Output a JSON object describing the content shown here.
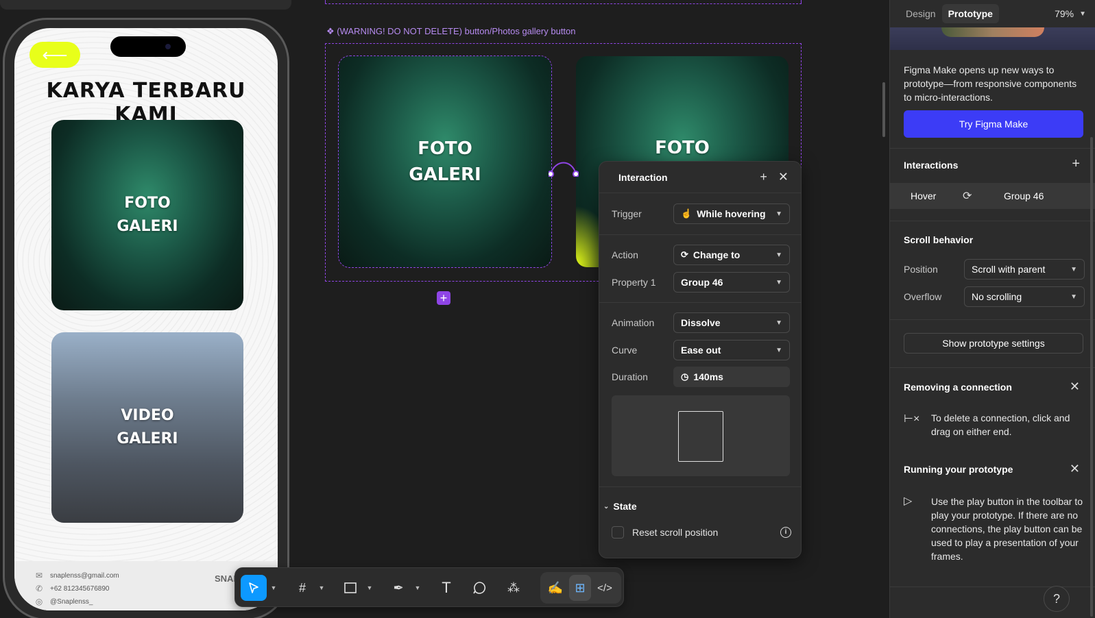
{
  "phone": {
    "back_arrow": "⟵",
    "title": "KARYA TERBARU KAMI",
    "card1": {
      "line1": "FOTO",
      "line2": "GALERI"
    },
    "card2": {
      "line1": "VIDEO",
      "line2": "GALERI"
    },
    "footer": {
      "email": "snaplenss@gmail.com",
      "phone": "+62 812345676890",
      "instagram": "@Snaplenss_",
      "logo_text": "SNAP"
    }
  },
  "canvas": {
    "component_label": "❖ (WARNING! DO NOT DELETE) button/Photos gallery button",
    "variant1": {
      "line1": "FOTO",
      "line2": "GALERI"
    },
    "variant2": {
      "line1": "FOTO",
      "line2": ""
    }
  },
  "interaction": {
    "title": "Interaction",
    "trigger_label": "Trigger",
    "trigger_value": "While hovering",
    "action_label": "Action",
    "action_value": "Change to",
    "property_label": "Property 1",
    "property_value": "Group 46",
    "animation_label": "Animation",
    "animation_value": "Dissolve",
    "curve_label": "Curve",
    "curve_value": "Ease out",
    "duration_label": "Duration",
    "duration_value": "140ms",
    "state_title": "State",
    "reset_scroll_label": "Reset scroll position"
  },
  "right_panel": {
    "tab_design": "Design",
    "tab_prototype": "Prototype",
    "zoom": "79%",
    "promo_text": "Figma Make opens up new ways to prototype—from responsive components to micro-interactions.",
    "cta": "Try Figma Make",
    "interactions_title": "Interactions",
    "interaction_trigger": "Hover",
    "interaction_target": "Group 46",
    "scroll_title": "Scroll behavior",
    "position_label": "Position",
    "position_value": "Scroll with parent",
    "overflow_label": "Overflow",
    "overflow_value": "No scrolling",
    "show_settings": "Show prototype settings",
    "tip1_title": "Removing a connection",
    "tip1_text": "To delete a connection, click and drag on either end.",
    "tip2_title": "Running your prototype",
    "tip2_text": "Use the play button in the toolbar to play your prototype. If there are no connections, the play button can be used to play a presentation of your frames."
  },
  "colors": {
    "accent_purple": "#8f45e6",
    "figma_blue": "#0d99ff",
    "cta_blue": "#3c3cf6",
    "back_btn_yellow": "#e8ff1a"
  }
}
